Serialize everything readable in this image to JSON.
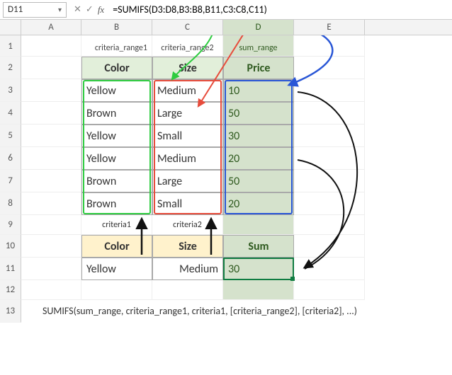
{
  "formula_bar": {
    "namebox": "D11",
    "fx_label": "fx",
    "formula": "=SUMIFS(D3:D8,B3:B8,B11,C3:C8,C11)"
  },
  "columns": {
    "A": "A",
    "B": "B",
    "C": "C",
    "D": "D",
    "E": "E"
  },
  "rows": [
    "1",
    "2",
    "3",
    "4",
    "5",
    "6",
    "7",
    "8",
    "9",
    "10",
    "11",
    "12",
    "13"
  ],
  "labels": {
    "criteria_range1": "criteria_range1",
    "criteria_range2": "criteria_range2",
    "sum_range": "sum_range",
    "criteria1": "criteria1",
    "criteria2": "criteria2"
  },
  "table1": {
    "headers": {
      "color": "Color",
      "size": "Size",
      "price": "Price"
    },
    "rows": [
      {
        "color": "Yellow",
        "size": "Medium",
        "price": "10"
      },
      {
        "color": "Brown",
        "size": "Large",
        "price": "50"
      },
      {
        "color": "Yellow",
        "size": "Small",
        "price": "30"
      },
      {
        "color": "Yellow",
        "size": "Medium",
        "price": "20"
      },
      {
        "color": "Brown",
        "size": "Large",
        "price": "50"
      },
      {
        "color": "Brown",
        "size": "Small",
        "price": "20"
      }
    ]
  },
  "table2": {
    "headers": {
      "color": "Color",
      "size": "Size",
      "sum": "Sum"
    },
    "row": {
      "color": "Yellow",
      "size": "Medium",
      "sum": "30"
    }
  },
  "syntax": "SUMIFS(sum_range, criteria_range1, criteria1, [criteria_range2], [criteria2], ...)",
  "colors": {
    "green": "#2ecc40",
    "red": "#e74c3c",
    "blue": "#2956d6",
    "black": "#111"
  }
}
